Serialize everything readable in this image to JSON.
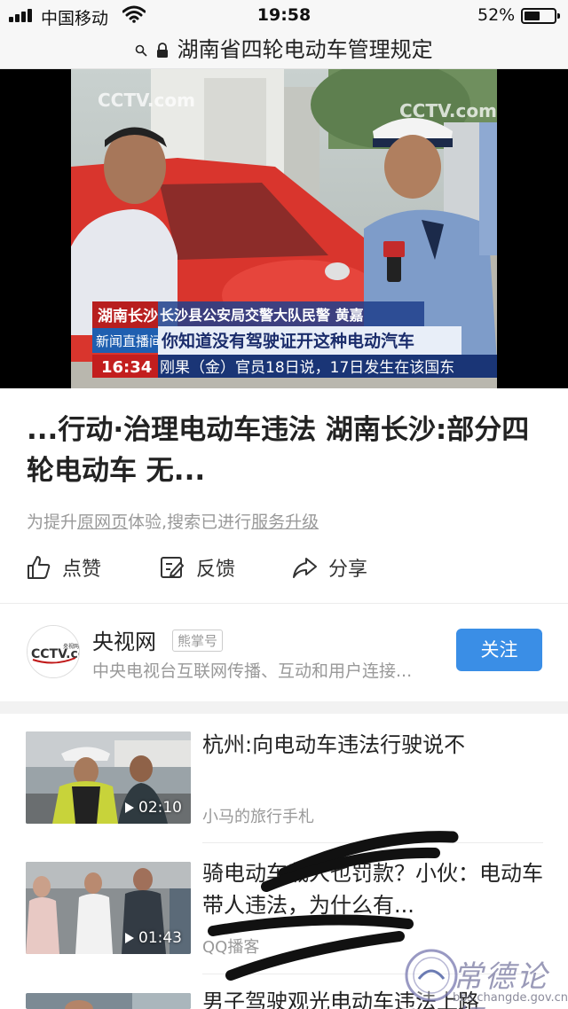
{
  "status_bar": {
    "carrier": "中国移动",
    "time": "19:58",
    "battery_percent": "52%",
    "battery_level": 0.52
  },
  "address_bar": {
    "title": "湖南省四轮电动车管理规定"
  },
  "video": {
    "logo": "CCTV.com",
    "location_tag": "湖南长沙",
    "speaker_caption": "长沙县公安局交警大队民警 黄嘉",
    "program_tag": "新闻直播间",
    "subtitle": "你知道没有驾驶证开这种电动汽车",
    "clock": "16:34",
    "ticker": "刚果（金）官员18日说，17日发生在该国东"
  },
  "article": {
    "headline": "...行动·治理电动车违法 湖南长沙:部分四轮电动车 无...",
    "notice_prefix": "为提升",
    "notice_link1": "原网页",
    "notice_middle": "体验,搜索已进行",
    "notice_link2": "服务升级"
  },
  "actions": {
    "like": "点赞",
    "feedback": "反馈",
    "share": "分享"
  },
  "author": {
    "name": "央视网",
    "tag": "熊掌号",
    "description": "中央电视台互联网传播、互动和用户连接...",
    "follow_label": "关注",
    "avatar_logo": "CCTV.com",
    "avatar_sub": "央视网"
  },
  "related": [
    {
      "title": "杭州:向电动车违法行驶说不",
      "source": "小马的旅行手札",
      "duration": "02:10"
    },
    {
      "title": "骑电动车载人也罚款？小伙：电动车带人违法，为什么有...",
      "source": "QQ播客",
      "duration": "01:43"
    },
    {
      "title": "男子驾驶观光电动车违法上路"
    }
  ],
  "watermark": {
    "text": "常德论坛",
    "url": "bbs.changde.gov.cn"
  },
  "colors": {
    "accent_blue": "#3a8ee6",
    "text_primary": "#222222",
    "text_secondary": "#999999"
  }
}
